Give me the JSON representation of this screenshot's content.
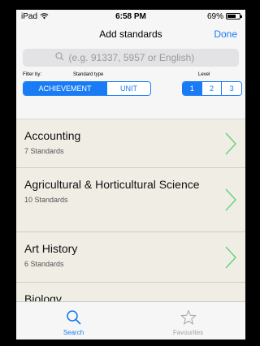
{
  "status": {
    "device": "iPad",
    "time": "6:58 PM",
    "battery": "69%",
    "battery_level": 0.69
  },
  "nav": {
    "title": "Add standards",
    "done_label": "Done"
  },
  "search": {
    "placeholder": "(e.g. 91337, 5957 or English)"
  },
  "filters": {
    "filter_by_label": "Filter by:",
    "standard_type_label": "Standard type",
    "level_label": "Level",
    "type_options": [
      "ACHIEVEMENT",
      "UNIT"
    ],
    "type_selected": "ACHIEVEMENT",
    "level_options": [
      "1",
      "2",
      "3"
    ],
    "level_selected": "1"
  },
  "list": {
    "items": [
      {
        "title": "Accounting",
        "subtitle": "7 Standards"
      },
      {
        "title": "Agricultural & Horticultural Science",
        "subtitle": "10 Standards"
      },
      {
        "title": "Art History",
        "subtitle": "6 Standards"
      },
      {
        "title": "Biology",
        "subtitle": ""
      }
    ]
  },
  "tabs": [
    {
      "label": "Search",
      "icon": "search-icon",
      "active": true
    },
    {
      "label": "Favourites",
      "icon": "star-icon",
      "active": false
    }
  ],
  "colors": {
    "accent": "#1a7cf4",
    "list_bg": "#efede4",
    "chevron": "#5fd07a"
  }
}
